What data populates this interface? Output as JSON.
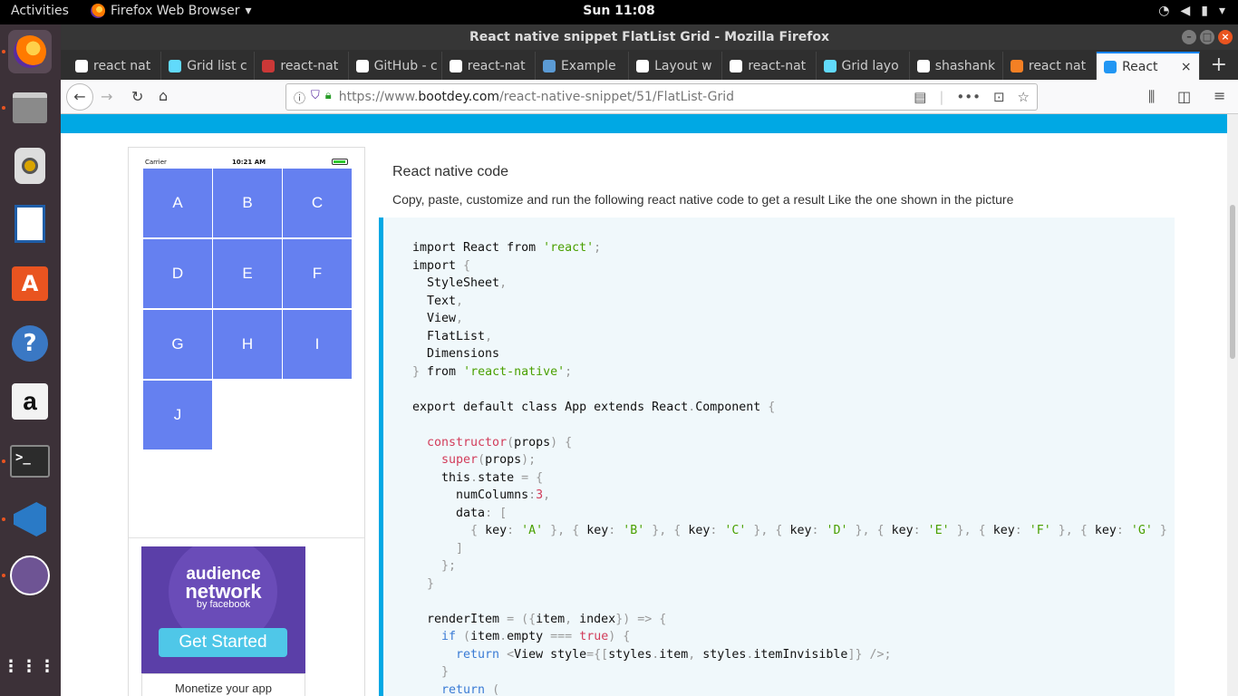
{
  "topbar": {
    "activities": "Activities",
    "app_name": "Firefox Web Browser",
    "clock": "Sun 11:08"
  },
  "window": {
    "title": "React native snippet FlatList Grid - Mozilla Firefox"
  },
  "tabs": [
    {
      "label": "react nat",
      "favicon_color": "#ffffff"
    },
    {
      "label": "Grid list c",
      "favicon_color": "#61dafb"
    },
    {
      "label": "react-nat",
      "favicon_color": "#cb3837"
    },
    {
      "label": "GitHub - c",
      "favicon_color": "#ffffff"
    },
    {
      "label": "react-nat",
      "favicon_color": "#ffffff"
    },
    {
      "label": "Example",
      "favicon_color": "#5b9bd5"
    },
    {
      "label": "Layout w",
      "favicon_color": "#ffffff"
    },
    {
      "label": "react-nat",
      "favicon_color": "#ffffff"
    },
    {
      "label": "Grid layo",
      "favicon_color": "#61dafb"
    },
    {
      "label": "shashank",
      "favicon_color": "#ffffff"
    },
    {
      "label": "react nat",
      "favicon_color": "#f48024"
    },
    {
      "label": "React",
      "favicon_color": "#2196f3",
      "active": true
    }
  ],
  "url": {
    "scheme": "https://www.",
    "host": "bootdey.com",
    "path": "/react-native-snippet/51/FlatList-Grid"
  },
  "preview": {
    "carrier": "Carrier",
    "time": "10:21 AM",
    "cells": [
      "A",
      "B",
      "C",
      "D",
      "E",
      "F",
      "G",
      "H",
      "I",
      "J"
    ]
  },
  "ad": {
    "line1": "audience",
    "line2": "network",
    "line3": "by facebook",
    "button": "Get Started",
    "bottom": "Monetize your app"
  },
  "content": {
    "title": "React native code",
    "description": "Copy, paste, customize and run the following react native code to get a result Like the one shown in the picture"
  },
  "colors": {
    "accent": "#00a8e4",
    "cell": "#6580f0"
  }
}
